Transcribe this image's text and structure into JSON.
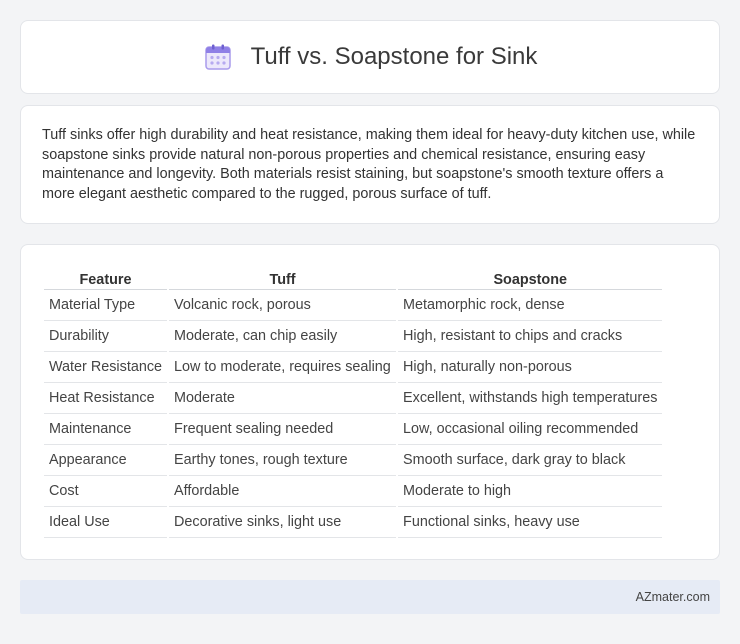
{
  "header": {
    "title": "Tuff vs. Soapstone for Sink",
    "icon": "calendar-icon"
  },
  "summary": {
    "text": "Tuff sinks offer high durability and heat resistance, making them ideal for heavy-duty kitchen use, while soapstone sinks provide natural non-porous properties and chemical resistance, ensuring easy maintenance and longevity. Both materials resist staining, but soapstone's smooth texture offers a more elegant aesthetic compared to the rugged, porous surface of tuff."
  },
  "table": {
    "headers": [
      "Feature",
      "Tuff",
      "Soapstone"
    ],
    "rows": [
      [
        "Material Type",
        "Volcanic rock, porous",
        "Metamorphic rock, dense"
      ],
      [
        "Durability",
        "Moderate, can chip easily",
        "High, resistant to chips and cracks"
      ],
      [
        "Water Resistance",
        "Low to moderate, requires sealing",
        "High, naturally non-porous"
      ],
      [
        "Heat Resistance",
        "Moderate",
        "Excellent, withstands high temperatures"
      ],
      [
        "Maintenance",
        "Frequent sealing needed",
        "Low, occasional oiling recommended"
      ],
      [
        "Appearance",
        "Earthy tones, rough texture",
        "Smooth surface, dark gray to black"
      ],
      [
        "Cost",
        "Affordable",
        "Moderate to high"
      ],
      [
        "Ideal Use",
        "Decorative sinks, light use",
        "Functional sinks, heavy use"
      ]
    ]
  },
  "footer": {
    "text": "AZmater.com"
  },
  "colors": {
    "background": "#f3f4f6",
    "card": "#ffffff",
    "footer_bg": "#e6ebf5",
    "icon_accent": "#9b8ce8"
  }
}
